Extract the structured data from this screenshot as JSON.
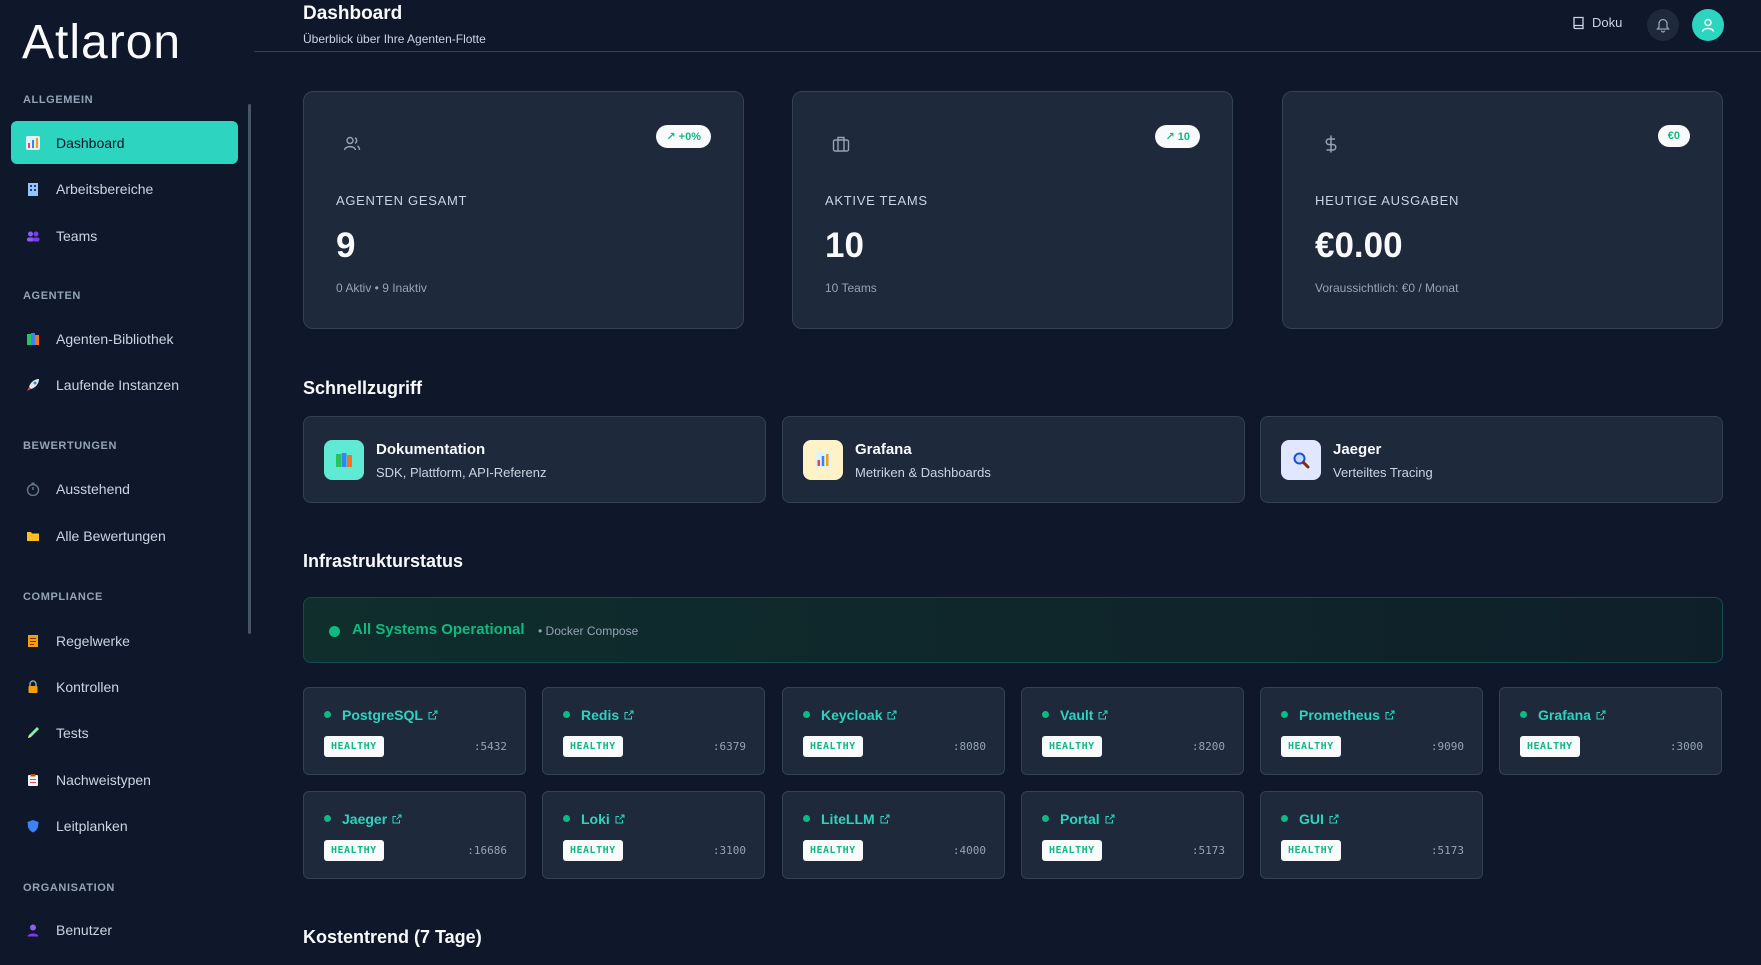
{
  "app": {
    "logo_text": "Atlaron"
  },
  "header": {
    "title": "Dashboard",
    "subtitle": "Überblick über Ihre Agenten-Flotte",
    "docs_label": "Doku"
  },
  "sidebar": {
    "sections": [
      {
        "label": "Allgemein",
        "items": [
          {
            "label": "Dashboard",
            "icon": "bar-chart-icon",
            "active": true
          },
          {
            "label": "Arbeitsbereiche",
            "icon": "building-icon"
          },
          {
            "label": "Teams",
            "icon": "users-icon"
          }
        ]
      },
      {
        "label": "Agenten",
        "items": [
          {
            "label": "Agenten-Bibliothek",
            "icon": "books-icon"
          },
          {
            "label": "Laufende Instanzen",
            "icon": "rocket-icon"
          }
        ]
      },
      {
        "label": "Bewertungen",
        "items": [
          {
            "label": "Ausstehend",
            "icon": "stopwatch-icon"
          },
          {
            "label": "Alle Bewertungen",
            "icon": "folder-icon"
          }
        ]
      },
      {
        "label": "Compliance",
        "items": [
          {
            "label": "Regelwerke",
            "icon": "ledger-icon"
          },
          {
            "label": "Kontrollen",
            "icon": "lock-icon"
          },
          {
            "label": "Tests",
            "icon": "pen-icon"
          },
          {
            "label": "Nachweistypen",
            "icon": "clipboard-icon"
          },
          {
            "label": "Leitplanken",
            "icon": "shield-icon"
          }
        ]
      },
      {
        "label": "Organisation",
        "items": [
          {
            "label": "Benutzer",
            "icon": "user-icon"
          }
        ]
      }
    ]
  },
  "stats": [
    {
      "label": "Agenten gesamt",
      "value": "9",
      "sub": "0 Aktiv • 9 Inaktiv",
      "badge": "↗ +0%",
      "icon": "users-icon"
    },
    {
      "label": "Aktive Teams",
      "value": "10",
      "sub": "10 Teams",
      "badge": "↗ 10",
      "icon": "briefcase-icon"
    },
    {
      "label": "Heutige Ausgaben",
      "value": "€0.00",
      "sub": "Voraussichtlich: €0 / Monat",
      "badge": "€0",
      "icon": "dollar-icon"
    }
  ],
  "quick_access": {
    "title": "Schnellzugriff",
    "items": [
      {
        "title": "Dokumentation",
        "desc": "SDK, Plattform, API-Referenz",
        "icon": "books-icon",
        "bg": "#5eead4"
      },
      {
        "title": "Grafana",
        "desc": "Metriken & Dashboards",
        "icon": "bar-chart-icon",
        "bg": "#fef3c7"
      },
      {
        "title": "Jaeger",
        "desc": "Verteiltes Tracing",
        "icon": "magnifier-icon",
        "bg": "#e0e7ff"
      }
    ]
  },
  "infrastructure": {
    "title": "Infrastrukturstatus",
    "status_text": "All Systems Operational",
    "environment": "• Docker Compose",
    "services": [
      {
        "name": "PostgreSQL",
        "status": "HEALTHY",
        "port": ":5432"
      },
      {
        "name": "Redis",
        "status": "HEALTHY",
        "port": ":6379"
      },
      {
        "name": "Keycloak",
        "status": "HEALTHY",
        "port": ":8080"
      },
      {
        "name": "Vault",
        "status": "HEALTHY",
        "port": ":8200"
      },
      {
        "name": "Prometheus",
        "status": "HEALTHY",
        "port": ":9090"
      },
      {
        "name": "Grafana",
        "status": "HEALTHY",
        "port": ":3000"
      },
      {
        "name": "Jaeger",
        "status": "HEALTHY",
        "port": ":16686"
      },
      {
        "name": "Loki",
        "status": "HEALTHY",
        "port": ":3100"
      },
      {
        "name": "LiteLLM",
        "status": "HEALTHY",
        "port": ":4000"
      },
      {
        "name": "Portal",
        "status": "HEALTHY",
        "port": ":5173"
      },
      {
        "name": "GUI",
        "status": "HEALTHY",
        "port": ":5173"
      }
    ]
  },
  "cost_trend": {
    "title": "Kostentrend (7 Tage)"
  },
  "colors": {
    "accent": "#2dd4bf",
    "healthy": "#10b981",
    "background": "#0f172a",
    "card": "#1e293b"
  }
}
